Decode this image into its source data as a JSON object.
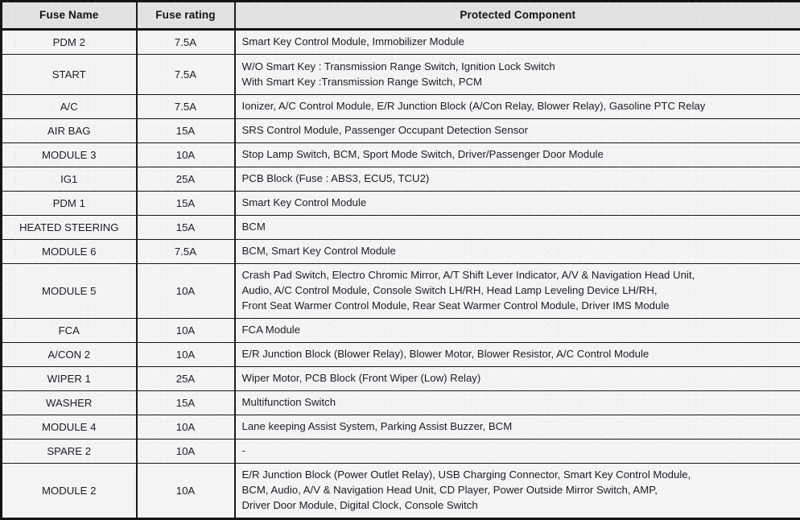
{
  "table": {
    "name": "interior-fuse-panel-table",
    "columns": [
      {
        "key": "fuse_name",
        "label": "Fuse Name"
      },
      {
        "key": "fuse_rating",
        "label": "Fuse rating"
      },
      {
        "key": "protected_component",
        "label": "Protected Component"
      }
    ],
    "rows": [
      {
        "fuse_name": "PDM 2",
        "fuse_rating": "7.5A",
        "protected_component": [
          "Smart Key Control Module, Immobilizer Module"
        ]
      },
      {
        "fuse_name": "START",
        "fuse_rating": "7.5A",
        "protected_component": [
          "W/O Smart Key : Transmission Range Switch, Ignition Lock Switch",
          "With Smart Key :Transmission Range Switch, PCM"
        ]
      },
      {
        "fuse_name": "A/C",
        "fuse_rating": "7.5A",
        "protected_component": [
          "Ionizer, A/C Control Module, E/R Junction Block (A/Con Relay, Blower Relay), Gasoline PTC Relay"
        ]
      },
      {
        "fuse_name": "AIR BAG",
        "fuse_rating": "15A",
        "protected_component": [
          "SRS Control Module, Passenger Occupant Detection Sensor"
        ]
      },
      {
        "fuse_name": "MODULE 3",
        "fuse_rating": "10A",
        "protected_component": [
          "Stop Lamp Switch, BCM, Sport Mode Switch, Driver/Passenger Door Module"
        ]
      },
      {
        "fuse_name": "IG1",
        "fuse_rating": "25A",
        "protected_component": [
          "PCB Block (Fuse : ABS3, ECU5, TCU2)"
        ]
      },
      {
        "fuse_name": "PDM 1",
        "fuse_rating": "15A",
        "protected_component": [
          "Smart Key Control Module"
        ]
      },
      {
        "fuse_name": "HEATED STEERING",
        "fuse_rating": "15A",
        "protected_component": [
          "BCM"
        ]
      },
      {
        "fuse_name": "MODULE 6",
        "fuse_rating": "7.5A",
        "protected_component": [
          "BCM, Smart Key Control Module"
        ]
      },
      {
        "fuse_name": "MODULE 5",
        "fuse_rating": "10A",
        "protected_component": [
          "Crash Pad Switch, Electro Chromic Mirror, A/T Shift Lever Indicator, A/V & Navigation Head Unit,",
          "Audio, A/C Control Module, Console Switch LH/RH, Head Lamp Leveling Device LH/RH,",
          "Front Seat Warmer Control Module, Rear Seat Warmer Control Module, Driver IMS Module"
        ]
      },
      {
        "fuse_name": "FCA",
        "fuse_rating": "10A",
        "protected_component": [
          "FCA Module"
        ]
      },
      {
        "fuse_name": "A/CON 2",
        "fuse_rating": "10A",
        "protected_component": [
          "E/R Junction Block (Blower Relay), Blower Motor, Blower Resistor, A/C Control Module"
        ]
      },
      {
        "fuse_name": "WIPER 1",
        "fuse_rating": "25A",
        "protected_component": [
          "Wiper Motor, PCB Block (Front Wiper (Low) Relay)"
        ]
      },
      {
        "fuse_name": "WASHER",
        "fuse_rating": "15A",
        "protected_component": [
          "Multifunction Switch"
        ]
      },
      {
        "fuse_name": "MODULE 4",
        "fuse_rating": "10A",
        "protected_component": [
          "Lane keeping Assist System, Parking Assist Buzzer, BCM"
        ]
      },
      {
        "fuse_name": "SPARE 2",
        "fuse_rating": "10A",
        "protected_component": [
          "-"
        ]
      },
      {
        "fuse_name": "MODULE 2",
        "fuse_rating": "10A",
        "protected_component": [
          "E/R Junction Block (Power Outlet Relay), USB Charging Connector, Smart Key Control Module,",
          "BCM, Audio, A/V & Navigation Head Unit, CD Player, Power Outside Mirror Switch, AMP,",
          "Driver Door Module, Digital Clock, Console Switch"
        ]
      }
    ]
  },
  "colors": {
    "header_bg": "#e2e2e2",
    "cell_bg": "#f4f4f4",
    "border": "#141414",
    "text": "#1b1b26"
  }
}
